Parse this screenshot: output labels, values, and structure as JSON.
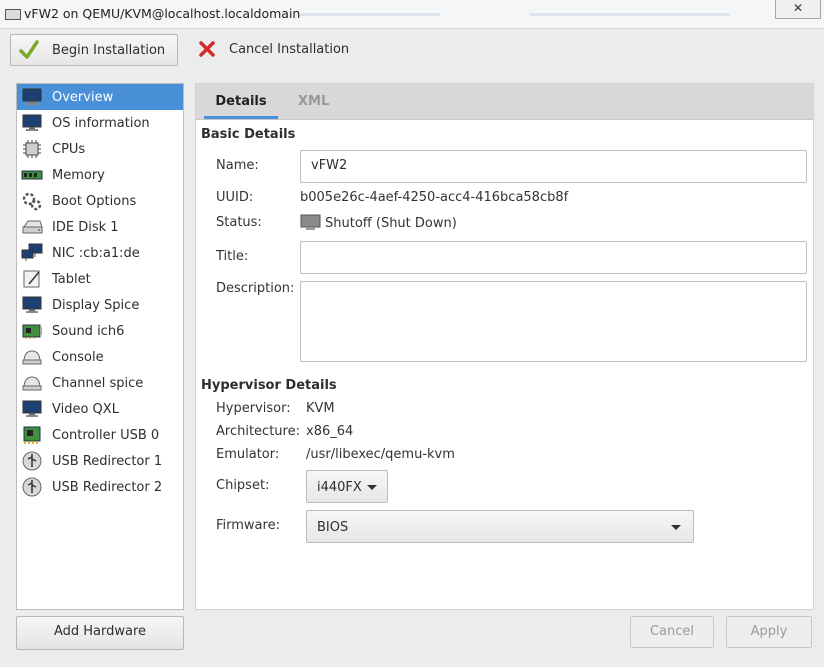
{
  "window": {
    "title": "vFW2 on QEMU/KVM@localhost.localdomain",
    "close_glyph": "✕"
  },
  "toolbar": {
    "begin_label": "Begin Installation",
    "cancel_label": "Cancel Installation"
  },
  "sidebar": {
    "items": [
      {
        "label": "Overview",
        "icon": "monitor-icon"
      },
      {
        "label": "OS information",
        "icon": "monitor-icon"
      },
      {
        "label": "CPUs",
        "icon": "cpu-icon"
      },
      {
        "label": "Memory",
        "icon": "memory-icon"
      },
      {
        "label": "Boot Options",
        "icon": "gears-icon"
      },
      {
        "label": "IDE Disk 1",
        "icon": "disk-icon"
      },
      {
        "label": "NIC :cb:a1:de",
        "icon": "network-icon"
      },
      {
        "label": "Tablet",
        "icon": "tablet-icon"
      },
      {
        "label": "Display Spice",
        "icon": "monitor-icon"
      },
      {
        "label": "Sound ich6",
        "icon": "sound-card-icon"
      },
      {
        "label": "Console",
        "icon": "serial-icon"
      },
      {
        "label": "Channel spice",
        "icon": "serial-icon"
      },
      {
        "label": "Video QXL",
        "icon": "monitor-icon"
      },
      {
        "label": "Controller USB 0",
        "icon": "pci-card-icon"
      },
      {
        "label": "USB Redirector 1",
        "icon": "usb-icon"
      },
      {
        "label": "USB Redirector 2",
        "icon": "usb-icon"
      }
    ],
    "add_hardware_label": "Add Hardware"
  },
  "tabs": {
    "details": "Details",
    "xml": "XML"
  },
  "basic": {
    "heading": "Basic Details",
    "name_label": "Name:",
    "name_value": "vFW2",
    "uuid_label": "UUID:",
    "uuid_value": "b005e26c-4aef-4250-acc4-416bca58cb8f",
    "status_label": "Status:",
    "status_value": "Shutoff (Shut Down)",
    "title_label": "Title:",
    "title_value": "",
    "description_label": "Description:",
    "description_value": ""
  },
  "hypervisor": {
    "heading": "Hypervisor Details",
    "hypervisor_label": "Hypervisor:",
    "hypervisor_value": "KVM",
    "architecture_label": "Architecture:",
    "architecture_value": "x86_64",
    "emulator_label": "Emulator:",
    "emulator_value": "/usr/libexec/qemu-kvm",
    "chipset_label": "Chipset:",
    "chipset_value": "i440FX",
    "firmware_label": "Firmware:",
    "firmware_value": "BIOS"
  },
  "footer": {
    "cancel_label": "Cancel",
    "apply_label": "Apply"
  },
  "colors": {
    "accent": "#4a90d9",
    "selected_text": "#ffffff"
  }
}
